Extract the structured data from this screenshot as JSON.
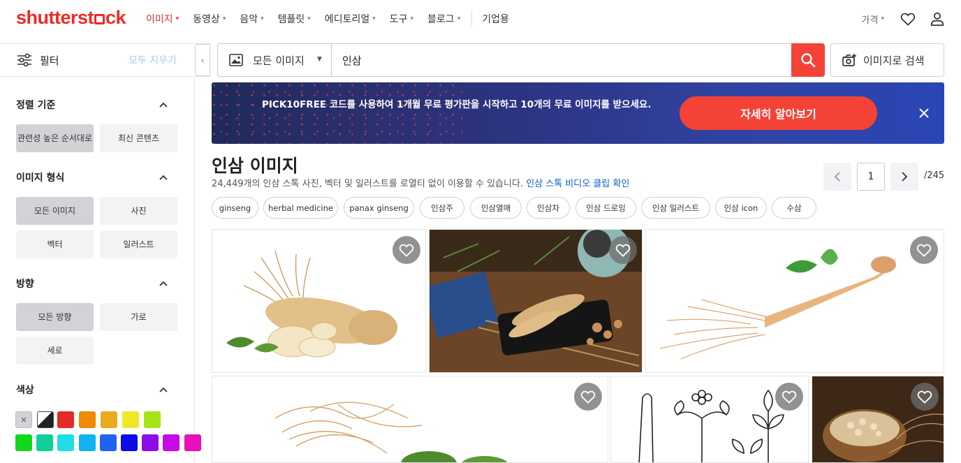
{
  "header": {
    "logo": "shutterstock",
    "nav": [
      {
        "label": "이미지",
        "active": true
      },
      {
        "label": "동영상"
      },
      {
        "label": "음악"
      },
      {
        "label": "템플릿"
      },
      {
        "label": "에디토리얼"
      },
      {
        "label": "도구"
      },
      {
        "label": "블로그"
      }
    ],
    "enterprise": "기업용",
    "price": "가격"
  },
  "filters": {
    "title": "필터",
    "clear_all": "모두 지우기",
    "sort": {
      "title": "정렬 기준",
      "options": [
        "관련성 높은 순서대로",
        "최신 콘텐츠"
      ],
      "selected": 0
    },
    "image_type": {
      "title": "이미지 형식",
      "options": [
        "모든 이미지",
        "사진",
        "벡터",
        "일러스트"
      ],
      "selected": 0
    },
    "orientation": {
      "title": "방향",
      "options": [
        "모든 방향",
        "가로",
        "세로"
      ],
      "selected": 0
    },
    "color": {
      "title": "색상",
      "clear_symbol": "×",
      "swatches": [
        "#e52a2a",
        "#f08a00",
        "#eaaa1f",
        "#efe829",
        "#a7e317",
        "#12d81c",
        "#0fcf9d",
        "#1ddde6",
        "#10b4f3",
        "#2262f0",
        "#0b0ce8",
        "#8c0cea",
        "#c60ae9",
        "#ea0fb6"
      ]
    }
  },
  "search": {
    "type_label": "모든 이미지",
    "query": "인삼",
    "image_search_label": "이미지로 검색"
  },
  "banner": {
    "text": "PICK10FREE 코드를 사용하여 1개월 무료 평가판을 시작하고 10개의 무료 이미지를 받으세요.",
    "cta": "자세히 알아보기"
  },
  "results": {
    "title": "인삼 이미지",
    "subtitle": "24,449개의 인삼 스톡 사진, 벡터 및 일러스트를 로열티 없이 이용할 수 있습니다.",
    "video_link": "인삼 스톡 비디오 클립 확인",
    "page": "1",
    "total_pages": "/245"
  },
  "chips": [
    "ginseng",
    "herbal medicine",
    "panax ginseng",
    "인삼주",
    "인삼열매",
    "인삼차",
    "인삼 드로잉",
    "인삼 일러스트",
    "인삼 icon",
    "수삼"
  ],
  "images": [
    {
      "name": "ginseng-roots-sliced-white"
    },
    {
      "name": "ginseng-on-black-plate-wood"
    },
    {
      "name": "ginseng-root-with-leaf-white"
    },
    {
      "name": "ginseng-root-large-white"
    },
    {
      "name": "ginseng-line-drawing"
    },
    {
      "name": "ginseng-in-wooden-bowl"
    }
  ]
}
